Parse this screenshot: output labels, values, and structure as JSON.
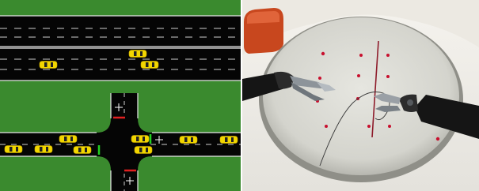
{
  "panels": [
    {
      "name": "traffic-simulation",
      "type": "top-down road intersection simulation"
    },
    {
      "name": "surgical-scene",
      "type": "robotic surgical instruments suturing on a practice pad"
    }
  ],
  "colors": {
    "grass": "#3a8a2e",
    "road": "#050505",
    "lane_marking": "#e8e8e8",
    "car_body": "#f2d600",
    "car_window": "#222222",
    "signal_green": "#22d022",
    "signal_red": "#e02020",
    "pad": "#dcdcd6",
    "pad_shadow": "#b9b9b2",
    "background_cloth": "#f2f0ea",
    "instrument": "#1a1a1a",
    "metal": "#9aa0a6",
    "marker_red": "#c8102e"
  }
}
